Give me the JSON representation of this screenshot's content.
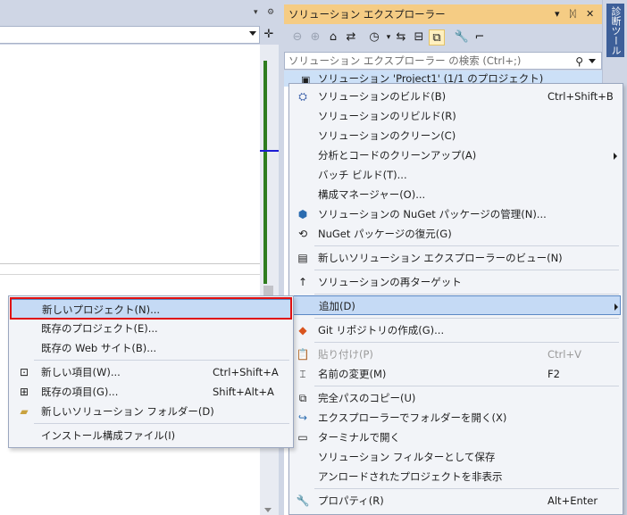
{
  "editor": {
    "tab_controls": {
      "dropdown": "▾",
      "settings": "⚙"
    },
    "split_icon": "✛"
  },
  "solution_explorer": {
    "title": "ソリューション エクスプローラー",
    "title_controls": {
      "dropdown": "▾",
      "pin": "ᛞ",
      "close": "✕"
    },
    "toolbar_icons": [
      "back-icon",
      "forward-icon",
      "home-icon",
      "switch-views-icon",
      "history-icon",
      "sync-icon",
      "collapse-all-icon",
      "show-all-files-icon",
      "properties-icon",
      "preview-icon"
    ],
    "search_placeholder": "ソリューション エクスプローラー の検索 (Ctrl+;)",
    "solution_node": "ソリューション 'Project1' (1/1 のプロジェクト)"
  },
  "side_strip": {
    "tab_label": "診断ツール"
  },
  "context_menu": {
    "items": [
      {
        "label": "ソリューションのビルド(B)",
        "shortcut": "Ctrl+Shift+B",
        "icon": "build-icon"
      },
      {
        "label": "ソリューションのリビルド(R)",
        "shortcut": ""
      },
      {
        "label": "ソリューションのクリーン(C)",
        "shortcut": ""
      },
      {
        "label": "分析とコードのクリーンアップ(A)",
        "shortcut": "",
        "submenu": true
      },
      {
        "label": "バッチ ビルド(T)...",
        "shortcut": ""
      },
      {
        "label": "構成マネージャー(O)...",
        "shortcut": ""
      },
      {
        "label": "ソリューションの NuGet パッケージの管理(N)...",
        "shortcut": "",
        "icon": "nuget-icon"
      },
      {
        "label": "NuGet パッケージの復元(G)",
        "shortcut": "",
        "icon": "restore-packages-icon"
      },
      {
        "label": "新しいソリューション エクスプローラーのビュー(N)",
        "shortcut": "",
        "icon": "new-view-icon"
      },
      {
        "label": "ソリューションの再ターゲット",
        "shortcut": "",
        "icon": "retarget-icon"
      },
      {
        "label": "追加(D)",
        "shortcut": "",
        "submenu": true
      },
      {
        "label": "Git リポジトリの作成(G)...",
        "shortcut": "",
        "icon": "git-icon"
      },
      {
        "label": "貼り付け(P)",
        "shortcut": "Ctrl+V",
        "icon": "paste-icon",
        "disabled": true
      },
      {
        "label": "名前の変更(M)",
        "shortcut": "F2",
        "icon": "rename-icon"
      },
      {
        "label": "完全パスのコピー(U)",
        "shortcut": "",
        "icon": "copy-icon"
      },
      {
        "label": "エクスプローラーでフォルダーを開く(X)",
        "shortcut": "",
        "icon": "open-folder-icon"
      },
      {
        "label": "ターミナルで開く",
        "shortcut": "",
        "icon": "terminal-icon"
      },
      {
        "label": "ソリューション フィルターとして保存",
        "shortcut": ""
      },
      {
        "label": "アンロードされたプロジェクトを非表示",
        "shortcut": ""
      },
      {
        "label": "プロパティ(R)",
        "shortcut": "Alt+Enter",
        "icon": "wrench-icon"
      }
    ]
  },
  "add_submenu": {
    "items": [
      {
        "label": "新しいプロジェクト(N)...",
        "shortcut": ""
      },
      {
        "label": "既存のプロジェクト(E)...",
        "shortcut": ""
      },
      {
        "label": "既存の Web サイト(B)...",
        "shortcut": ""
      },
      {
        "label": "新しい項目(W)...",
        "shortcut": "Ctrl+Shift+A",
        "icon": "new-item-icon"
      },
      {
        "label": "既存の項目(G)...",
        "shortcut": "Shift+Alt+A",
        "icon": "existing-item-icon"
      },
      {
        "label": "新しいソリューション フォルダー(D)",
        "shortcut": "",
        "icon": "new-folder-icon"
      },
      {
        "label": "インストール構成ファイル(I)",
        "shortcut": ""
      }
    ]
  }
}
